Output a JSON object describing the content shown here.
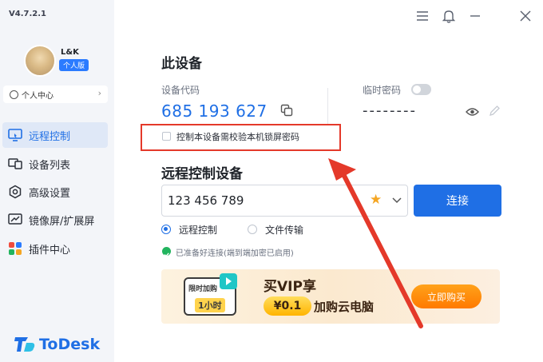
{
  "app": {
    "version": "V4.7.2.1",
    "logo_text": "ToDesk"
  },
  "user": {
    "name": "L&K",
    "edition": "个人版",
    "center_label": "个人中心",
    "center_chevron": "›"
  },
  "sidebar": {
    "items": [
      {
        "label": "远程控制",
        "icon": "remote-control-icon",
        "active": true
      },
      {
        "label": "设备列表",
        "icon": "device-list-icon",
        "active": false
      },
      {
        "label": "高级设置",
        "icon": "settings-icon",
        "active": false
      },
      {
        "label": "镜像屏/扩展屏",
        "icon": "mirror-screen-icon",
        "active": false
      },
      {
        "label": "插件中心",
        "icon": "plugin-icon",
        "active": false
      }
    ]
  },
  "this_device": {
    "heading": "此设备",
    "code_label": "设备代码",
    "code": "685 193 627",
    "temp_pwd_label": "临时密码",
    "temp_pwd_value": "--------",
    "temp_pwd_enabled": false,
    "lock_check_label": "控制本设备需校验本机锁屏密码",
    "lock_checked": false
  },
  "remote": {
    "heading": "远程控制设备",
    "id_value": "123 456 789",
    "star": "★",
    "connect_label": "连接",
    "modes": [
      {
        "label": "远程控制",
        "selected": true
      },
      {
        "label": "文件传输",
        "selected": false
      }
    ],
    "status_text": "已准备好连接(端到端加密已启用)"
  },
  "banner": {
    "card_top": "限时加购",
    "card_hour": "1小时",
    "vip_text": "买VIP享",
    "price": "¥0.1",
    "add_text": "加购云电脑",
    "buy_label": "立即购买"
  },
  "colors": {
    "accent": "#1f6fe5",
    "highlight": "#e4392a",
    "success": "#22b45e"
  }
}
